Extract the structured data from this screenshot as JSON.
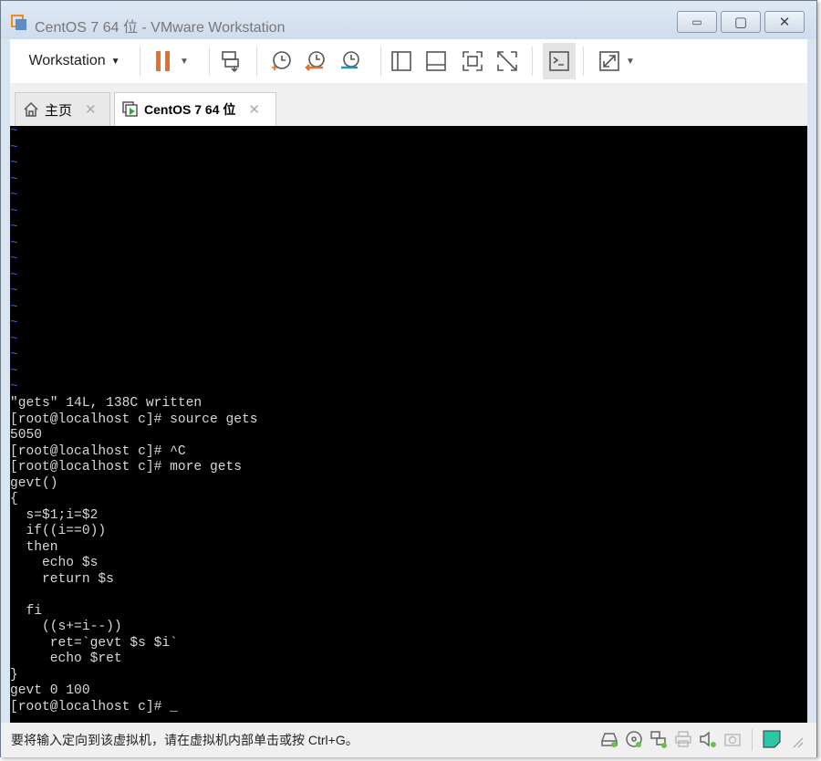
{
  "window": {
    "title": "CentOS 7 64 位 - VMware Workstation",
    "minimize": "▭",
    "maximize": "▢",
    "close": "✕"
  },
  "toolbar": {
    "workstation_menu": "Workstation",
    "accent": "#e8702a"
  },
  "tabs": [
    {
      "label": "主页",
      "icon": "home-icon",
      "close": "✕"
    },
    {
      "label": "CentOS 7 64 位",
      "icon": "vm-icon",
      "close": "✕",
      "active": true
    }
  ],
  "terminal": {
    "tilde": "~",
    "tilde_count": 17,
    "lines": [
      "\"gets\" 14L, 138C written",
      "[root@localhost c]# source gets",
      "5050",
      "[root@localhost c]# ^C",
      "[root@localhost c]# more gets",
      "gevt()",
      "{",
      "  s=$1;i=$2",
      "  if((i==0))",
      "  then",
      "    echo $s",
      "    return $s",
      "",
      "  fi",
      "    ((s+=i--))",
      "     ret=`gevt $s $i`",
      "     echo $ret",
      "}",
      "gevt 0 100",
      "[root@localhost c]# _"
    ]
  },
  "statusbar": {
    "message": "要将输入定向到该虚拟机，请在虚拟机内部单击或按 Ctrl+G。",
    "icons": [
      "hard-disk-icon",
      "cd-dvd-icon",
      "network-icon",
      "printer-icon",
      "sound-icon",
      "camera-icon",
      "note-icon"
    ]
  }
}
